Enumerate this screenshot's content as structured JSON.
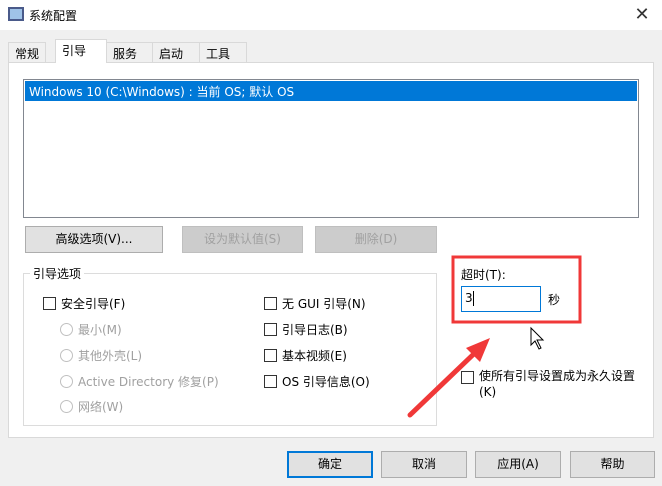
{
  "window": {
    "title": "系统配置",
    "close": "✕"
  },
  "tabs": [
    "常规",
    "引导",
    "服务",
    "启动",
    "工具"
  ],
  "boot_list": [
    "Windows 10 (C:\\Windows) : 当前 OS; 默认 OS"
  ],
  "buttons": {
    "advanced": "高级选项(V)...",
    "set_default": "设为默认值(S)",
    "delete": "删除(D)"
  },
  "boot_options": {
    "label": "引导选项",
    "safe_boot": "安全引导(F)",
    "minimal": "最小(M)",
    "alternate_shell": "其他外壳(L)",
    "ad_repair": "Active Directory 修复(P)",
    "network": "网络(W)",
    "no_gui": "无 GUI 引导(N)",
    "boot_log": "引导日志(B)",
    "base_video": "基本视频(E)",
    "os_boot_info": "OS 引导信息(O)"
  },
  "timeout": {
    "label": "超时(T):",
    "value": "3",
    "unit": "秒"
  },
  "permanent": "使所有引导设置成为永久设置(K)",
  "footer": {
    "ok": "确定",
    "cancel": "取消",
    "apply": "应用(A)",
    "help": "帮助"
  },
  "annotation_color": "#f03838"
}
